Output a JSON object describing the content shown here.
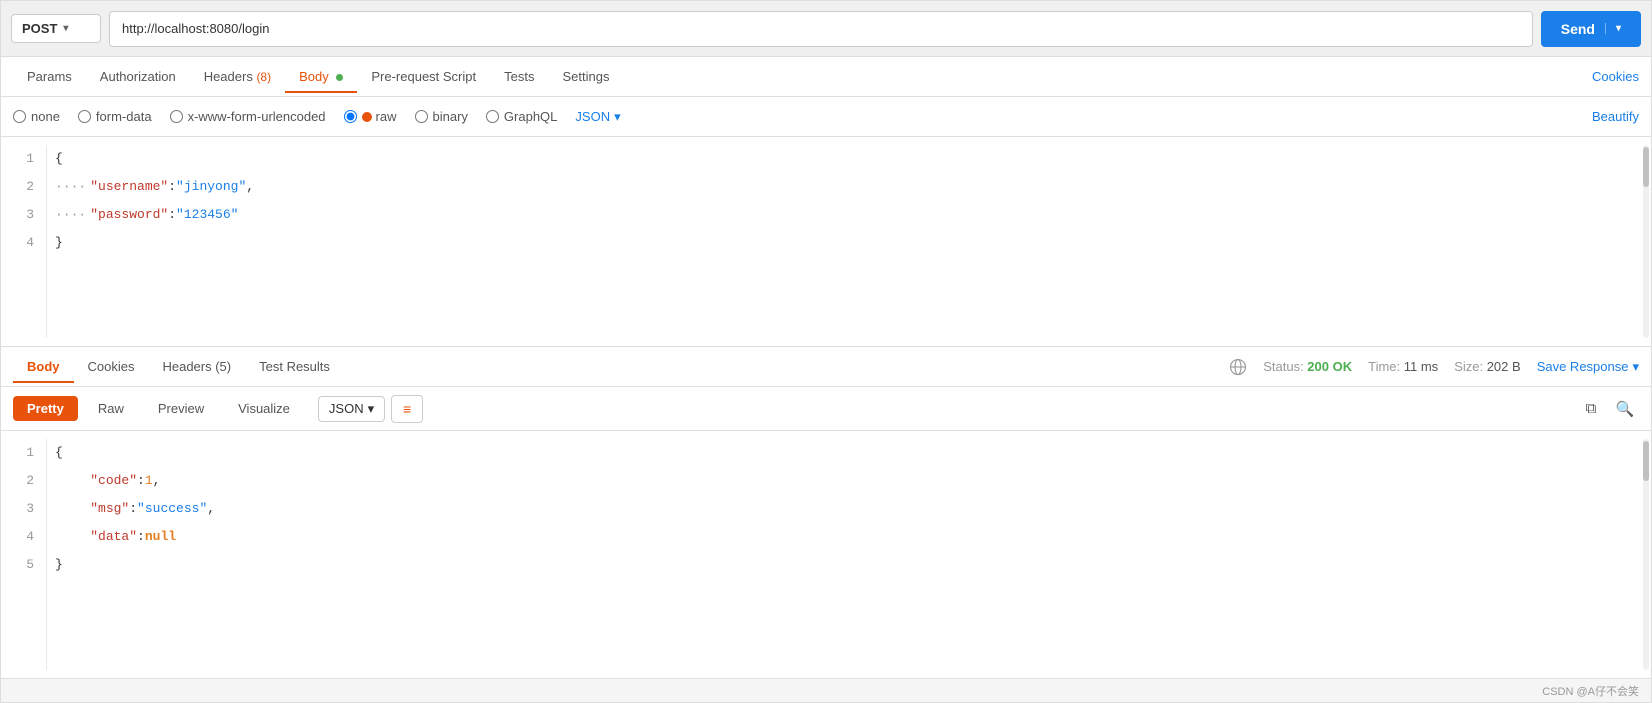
{
  "url_bar": {
    "method": "POST",
    "url": "http://localhost:8080/login",
    "send_label": "Send",
    "chevron": "▾"
  },
  "request_tabs": {
    "tabs": [
      {
        "id": "params",
        "label": "Params",
        "active": false
      },
      {
        "id": "authorization",
        "label": "Authorization",
        "active": false
      },
      {
        "id": "headers",
        "label": "Headers",
        "badge": "(8)",
        "active": false
      },
      {
        "id": "body",
        "label": "Body",
        "active": true,
        "has_dot": true
      },
      {
        "id": "pre-request",
        "label": "Pre-request Script",
        "active": false
      },
      {
        "id": "tests",
        "label": "Tests",
        "active": false
      },
      {
        "id": "settings",
        "label": "Settings",
        "active": false
      }
    ],
    "cookies_label": "Cookies"
  },
  "body_types": [
    {
      "id": "none",
      "label": "none",
      "checked": false
    },
    {
      "id": "form-data",
      "label": "form-data",
      "checked": false
    },
    {
      "id": "x-www-form-urlencoded",
      "label": "x-www-form-urlencoded",
      "checked": false
    },
    {
      "id": "raw",
      "label": "raw",
      "checked": true,
      "dot_color": "#e8520a"
    },
    {
      "id": "binary",
      "label": "binary",
      "checked": false
    },
    {
      "id": "graphql",
      "label": "GraphQL",
      "checked": false
    }
  ],
  "json_dropdown": {
    "label": "JSON",
    "chevron": "▾"
  },
  "beautify_label": "Beautify",
  "request_body": {
    "lines": [
      {
        "num": 1,
        "content": "{"
      },
      {
        "num": 2,
        "content": "    \"username\": \"jinyong\","
      },
      {
        "num": 3,
        "content": "    \"password\": \"123456\""
      },
      {
        "num": 4,
        "content": "}"
      }
    ]
  },
  "response_tabs": {
    "tabs": [
      {
        "id": "body",
        "label": "Body",
        "active": true
      },
      {
        "id": "cookies",
        "label": "Cookies",
        "active": false
      },
      {
        "id": "headers",
        "label": "Headers",
        "badge": "(5)",
        "active": false
      },
      {
        "id": "test-results",
        "label": "Test Results",
        "active": false
      }
    ],
    "status": "200 OK",
    "time": "11 ms",
    "size": "202 B",
    "save_response_label": "Save Response",
    "chevron": "▾"
  },
  "response_toolbar": {
    "formats": [
      {
        "id": "pretty",
        "label": "Pretty",
        "active": true
      },
      {
        "id": "raw",
        "label": "Raw",
        "active": false
      },
      {
        "id": "preview",
        "label": "Preview",
        "active": false
      },
      {
        "id": "visualize",
        "label": "Visualize",
        "active": false
      }
    ],
    "json_label": "JSON",
    "chevron": "▾"
  },
  "response_body": {
    "lines": [
      {
        "num": 1,
        "content": "{"
      },
      {
        "num": 2,
        "content": "    \"code\": 1,"
      },
      {
        "num": 3,
        "content": "    \"msg\": \"success\","
      },
      {
        "num": 4,
        "content": "    \"data\": null"
      },
      {
        "num": 5,
        "content": "}"
      }
    ]
  },
  "footer": {
    "text": "CSDN @A仔不会笑"
  }
}
